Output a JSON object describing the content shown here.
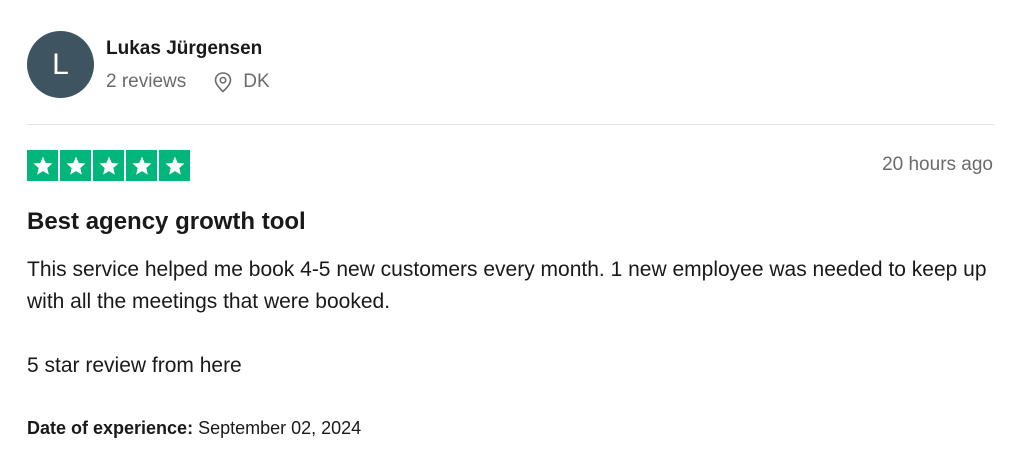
{
  "reviewer": {
    "initial": "L",
    "name": "Lukas Jürgensen",
    "reviews_count": "2 reviews",
    "country": "DK",
    "avatar_color": "#3f5461"
  },
  "review": {
    "rating": 5,
    "rating_max": 5,
    "star_color": "#00b67a",
    "time_ago": "20 hours ago",
    "title": "Best agency growth tool",
    "body": [
      "This service helped me book 4-5 new customers every month. 1 new employee was needed to keep up with all the meetings that were booked.",
      "5 star review from here"
    ],
    "experience_label": "Date of experience:",
    "experience_date": "September 02, 2024"
  },
  "icons": {
    "location": "location-pin-icon",
    "star": "star-icon"
  }
}
